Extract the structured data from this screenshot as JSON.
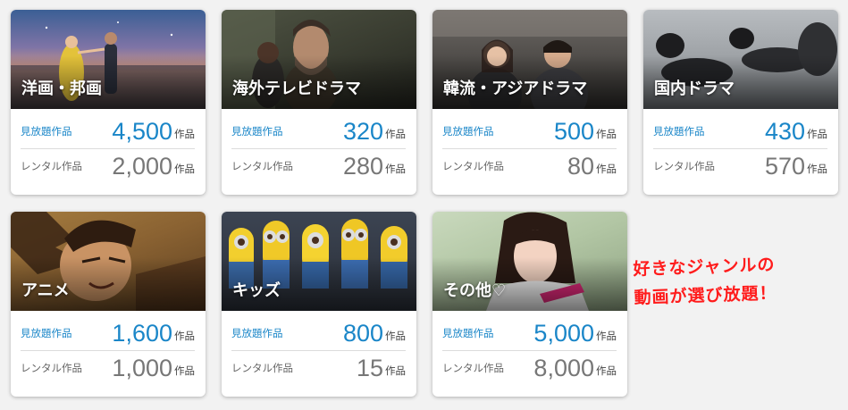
{
  "cards": [
    {
      "genre": "洋画・邦画",
      "unlimited_label": "見放題作品",
      "unlimited_count": "4,500",
      "rental_label": "レンタル作品",
      "rental_count": "2,000",
      "unit": "作品"
    },
    {
      "genre": "海外テレビドラマ",
      "unlimited_label": "見放題作品",
      "unlimited_count": "320",
      "rental_label": "レンタル作品",
      "rental_count": "280",
      "unit": "作品"
    },
    {
      "genre": "韓流・アジアドラマ",
      "unlimited_label": "見放題作品",
      "unlimited_count": "500",
      "rental_label": "レンタル作品",
      "rental_count": "80",
      "unit": "作品"
    },
    {
      "genre": "国内ドラマ",
      "unlimited_label": "見放題作品",
      "unlimited_count": "430",
      "rental_label": "レンタル作品",
      "rental_count": "570",
      "unit": "作品"
    },
    {
      "genre": "アニメ",
      "unlimited_label": "見放題作品",
      "unlimited_count": "1,600",
      "rental_label": "レンタル作品",
      "rental_count": "1,000",
      "unit": "作品"
    },
    {
      "genre": "キッズ",
      "unlimited_label": "見放題作品",
      "unlimited_count": "800",
      "rental_label": "レンタル作品",
      "rental_count": "15",
      "unit": "作品"
    },
    {
      "genre": "その他♡",
      "unlimited_label": "見放題作品",
      "unlimited_count": "5,000",
      "rental_label": "レンタル作品",
      "rental_count": "8,000",
      "unit": "作品"
    }
  ],
  "promo": {
    "line1": "好きなジャンルの",
    "line2": "動画が選び放題！"
  },
  "colors": {
    "unlimited_blue": "#1a86c8",
    "rental_gray": "#777777",
    "promo_red": "#ff1c1c"
  }
}
